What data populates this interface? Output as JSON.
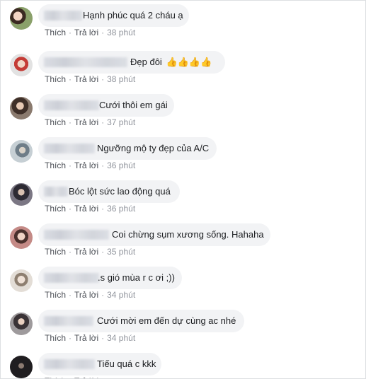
{
  "actions": {
    "like": "Thích",
    "reply": "Trả lời",
    "sep": "·"
  },
  "comments": [
    {
      "text": "Hạnh phúc quá 2 cháu ạ",
      "time": "38 phút",
      "avatar_color": "#7a8c5a"
    },
    {
      "text": "Đẹp đôi",
      "emoji": "👍👍👍👍",
      "time": "38 phút",
      "avatar_color": "#c9706a"
    },
    {
      "text": "Cưới thôi em gái",
      "time": "37 phút",
      "avatar_color": "#6a5a52"
    },
    {
      "text": "Ngưỡng mộ ty đẹp của A/C",
      "time": "36 phút",
      "avatar_color": "#9aa6b0"
    },
    {
      "text": "Bóc lột sức lao động quá",
      "time": "36 phút",
      "avatar_color": "#4c4a55"
    },
    {
      "text": "Coi chừng sụm xương sống. Hahaha",
      "time": "35 phút",
      "avatar_color": "#b07a78"
    },
    {
      "text": ".s gió mùa r c ơi ;))",
      "time": "34 phút",
      "avatar_color": "#c8c3bd"
    },
    {
      "text": "Cưới mời em đến dự cùng ac nhé",
      "time": "34 phút",
      "avatar_color": "#5d5a5c"
    },
    {
      "text": "Tiếu quá c kkk",
      "time": "",
      "avatar_color": "#2e2c2e"
    }
  ]
}
